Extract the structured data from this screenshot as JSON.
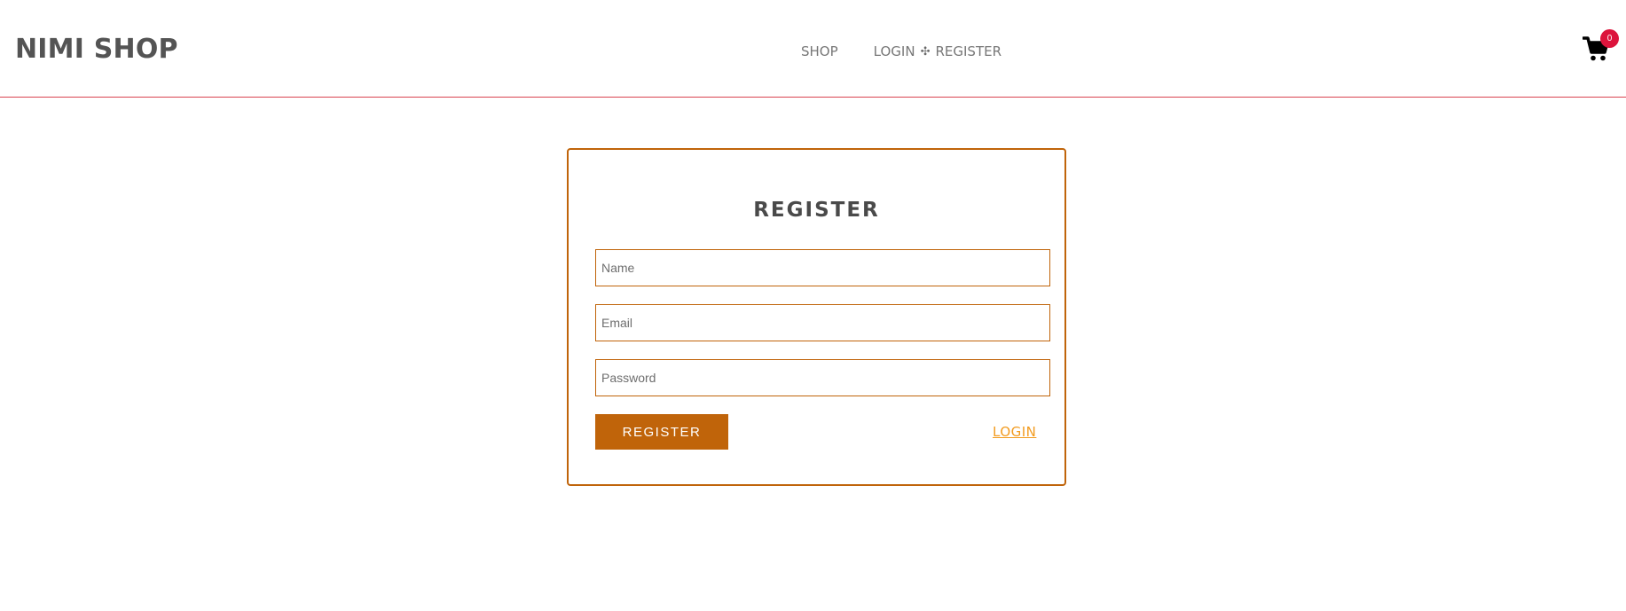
{
  "header": {
    "logo": "NIMI SHOP",
    "nav": {
      "shop": "SHOP",
      "login": "LOGIN",
      "separator": "✣",
      "register": "REGISTER"
    },
    "cart": {
      "icon": "cart-icon",
      "count": "0"
    }
  },
  "register_form": {
    "title": "REGISTER",
    "name_placeholder": "Name",
    "email_placeholder": "Email",
    "password_placeholder": "Password",
    "name_value": "",
    "email_value": "",
    "password_value": "",
    "submit_label": "REGISTER",
    "login_link": "LOGIN"
  },
  "colors": {
    "accent": "#c0640a",
    "link": "#f29b1f",
    "badge": "#dc143c",
    "header_border": "#d9434f",
    "text_dark": "#545454"
  }
}
